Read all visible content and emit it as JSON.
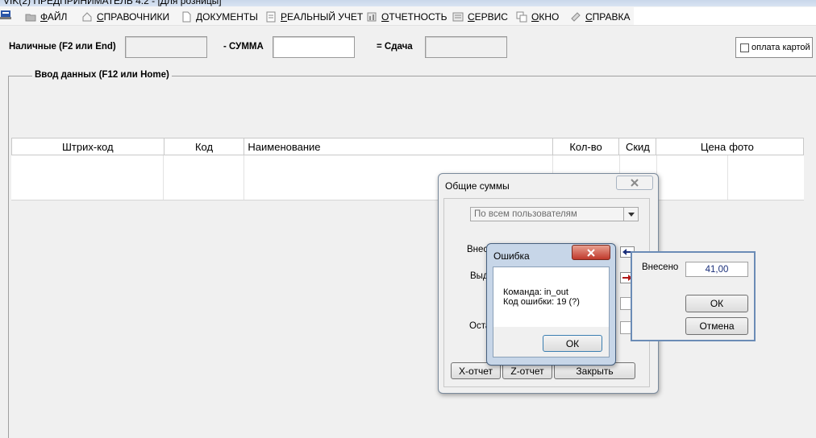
{
  "window": {
    "title": "VIK(2) ПРЕДПРИНИМАТЕЛЬ 4.2 - [Для розницы]"
  },
  "menu": {
    "items": [
      {
        "label": "ФАЙЛ",
        "icon": "folder-icon"
      },
      {
        "label": "СПРАВОЧНИКИ",
        "icon": "home-icon"
      },
      {
        "label": "ДОКУМЕНТЫ",
        "icon": "document-icon"
      },
      {
        "label": "РЕАЛЬНЫЙ УЧЕТ",
        "icon": "ledger-icon"
      },
      {
        "label": "ОТЧЕТНОСТЬ",
        "icon": "report-icon"
      },
      {
        "label": "СЕРВИС",
        "icon": "service-icon"
      },
      {
        "label": "ОКНО",
        "icon": "window-icon"
      },
      {
        "label": "СПРАВКА",
        "icon": "help-icon"
      }
    ]
  },
  "cash": {
    "cash_label": "Наличные (F2 или End)",
    "sum_label": "- СУММА",
    "change_label": "= Сдача",
    "card_label": "оплата картой"
  },
  "data_entry": {
    "group_title": "Ввод данных (F12 или Home)",
    "columns": [
      "Штрих-код",
      "Код",
      "Наименование",
      "Кол-во",
      "Скид",
      "Цена",
      "фото"
    ]
  },
  "totals_dialog": {
    "title": "Общие суммы",
    "user_filter": "По всем пользователям",
    "label_deposited_partial": "Внесе",
    "label_issued_partial": "Выд",
    "label_balance_partial": "Оста",
    "btn_x_report": "Х-отчет",
    "btn_z_report": "Z-отчет",
    "btn_close": "Закрыть"
  },
  "error_dialog": {
    "title": "Ошибка",
    "command_line": "Команда:  in_out",
    "error_code_line": "Код ошибки:  19 (?)",
    "ok": "ОК"
  },
  "deposit_dialog": {
    "label": "Внесено",
    "value": "41,00",
    "ok": "ОК",
    "cancel": "Отмена"
  }
}
